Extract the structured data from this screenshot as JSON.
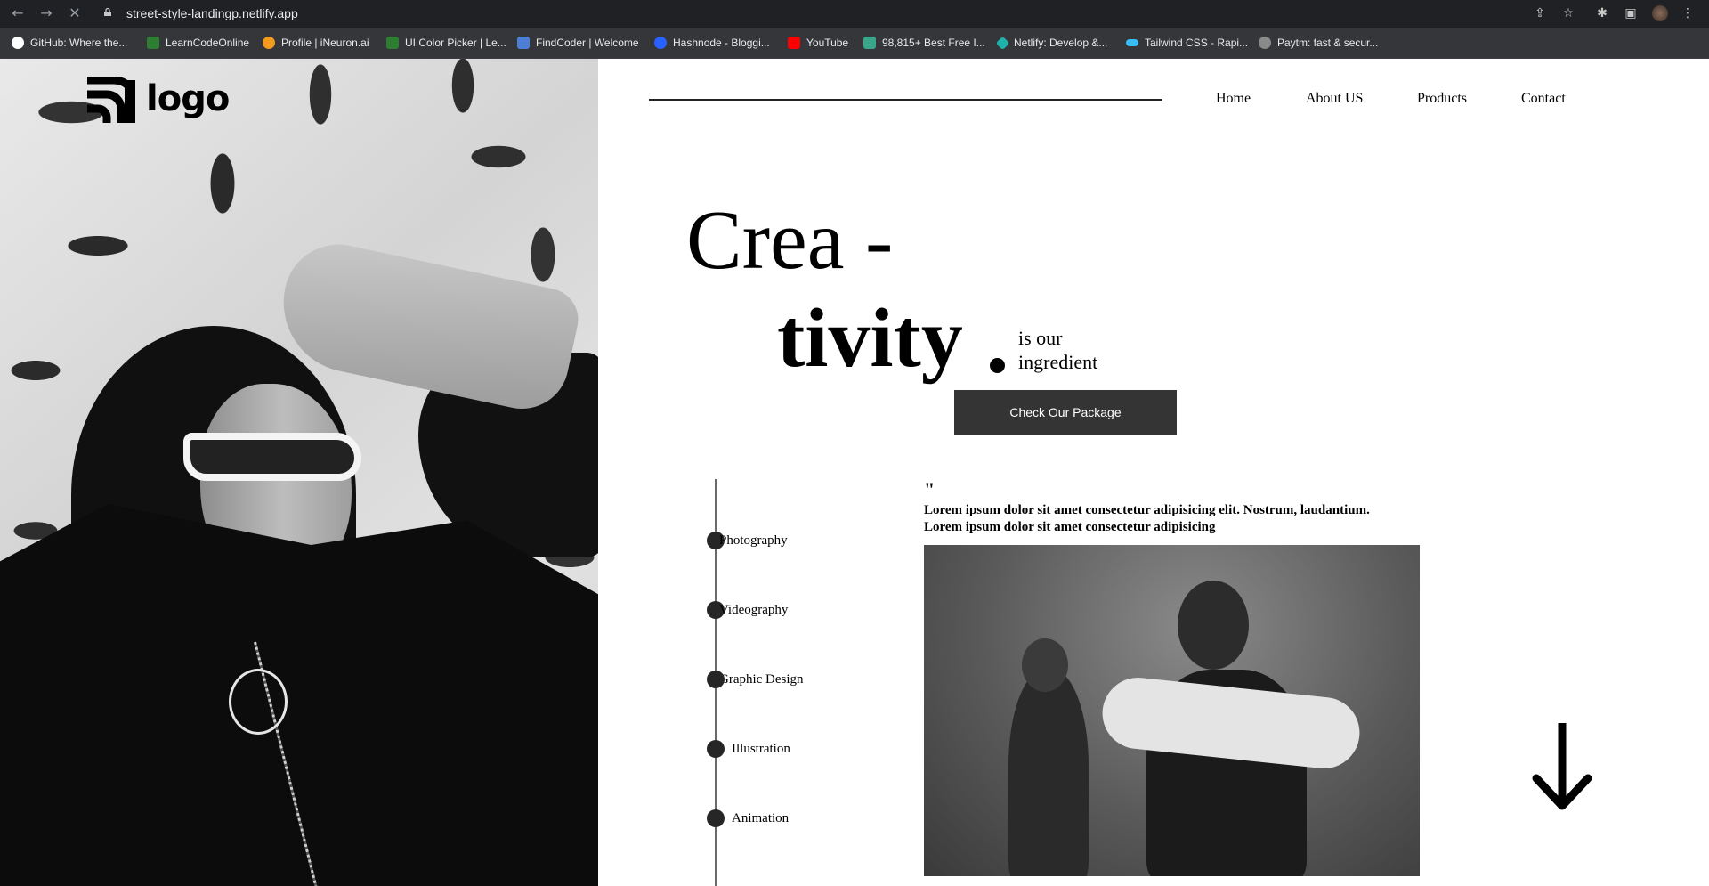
{
  "browser": {
    "url": "street-style-landingp.netlify.app",
    "bookmarks": [
      {
        "label": "GitHub: Where the...",
        "icon": "github-icon",
        "color": "#ffffff"
      },
      {
        "label": "LearnCodeOnline",
        "icon": "learncodeonline-icon",
        "color": "#2e7d32"
      },
      {
        "label": "Profile | iNeuron.ai",
        "icon": "ineuron-icon",
        "color": "#f29b1d"
      },
      {
        "label": "UI Color Picker | Le...",
        "icon": "ui-color-picker-icon",
        "color": "#2e7d32"
      },
      {
        "label": "FindCoder | Welcome",
        "icon": "findcoder-icon",
        "color": "#4e7fd6"
      },
      {
        "label": "Hashnode - Bloggi...",
        "icon": "hashnode-icon",
        "color": "#2962ff"
      },
      {
        "label": "YouTube",
        "icon": "youtube-icon",
        "color": "#ff0000"
      },
      {
        "label": "98,815+ Best Free I...",
        "icon": "freepik-icon",
        "color": "#3ba58c"
      },
      {
        "label": "Netlify: Develop &...",
        "icon": "netlify-icon",
        "color": "#20b2aa"
      },
      {
        "label": "Tailwind CSS - Rapi...",
        "icon": "tailwind-icon",
        "color": "#38bdf8"
      },
      {
        "label": "Paytm: fast & secur...",
        "icon": "paytm-icon",
        "color": "#8a8a8a"
      }
    ]
  },
  "site": {
    "logo_text": "logo",
    "nav": {
      "home": "Home",
      "about": "About US",
      "products": "Products",
      "contact": "Contact"
    },
    "hero": {
      "line1": "Crea -",
      "line2": "tivity",
      "tagline_1": "is our",
      "tagline_2": "ingredient",
      "cta": "Check Our Package"
    },
    "services": [
      "Photography",
      "Videography",
      "Graphic Design",
      "Illustration",
      "Animation"
    ],
    "quote": {
      "mark": "\"",
      "line1": "Lorem ipsum dolor sit amet consectetur adipisicing elit. Nostrum, laudantium.",
      "line2": "Lorem ipsum dolor sit amet consectetur adipisicing"
    }
  },
  "colors": {
    "accent_dark": "#343434",
    "chrome_bg": "#202124",
    "bookmarks_bg": "#35363a"
  },
  "icons": [
    "back-arrow-icon",
    "forward-arrow-icon",
    "stop-loading-icon",
    "lock-icon",
    "share-icon",
    "star-icon",
    "extensions-icon",
    "sidebar-icon",
    "profile-avatar",
    "more-menu-icon",
    "scroll-down-icon"
  ]
}
